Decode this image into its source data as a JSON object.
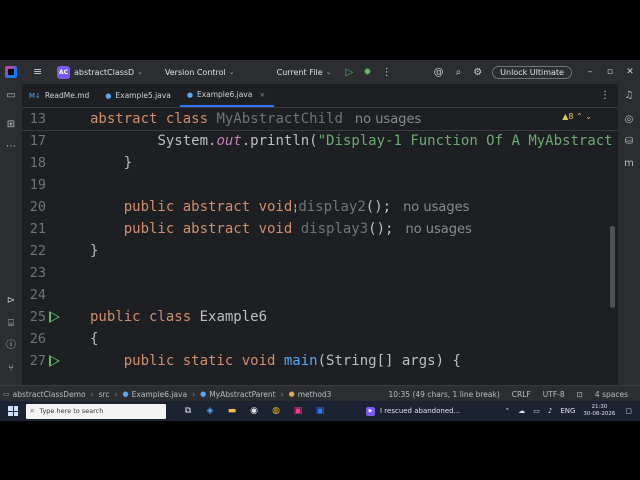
{
  "titlebar": {
    "project_badge": "AC",
    "project_name": "abstractClassD...",
    "vcs": "Version Control",
    "run_config": "Current File",
    "unlock": "Unlock Ultimate"
  },
  "tabs": [
    {
      "label": "ReadMe.md",
      "icon": "M↓",
      "active": false
    },
    {
      "label": "Example5.java",
      "icon": "●",
      "active": false
    },
    {
      "label": "Example6.java",
      "icon": "●",
      "active": true,
      "close": "×"
    }
  ],
  "editor": {
    "sticky": {
      "num": "13",
      "kw": "abstract class",
      "name": "MyAbstractChild",
      "hint": "no usages"
    },
    "inspection": "▲8  ⌃  ⌄",
    "lines": [
      {
        "num": "17",
        "indent": "        ",
        "pre": "System.",
        "field": "out",
        "mid": ".println(",
        "str": "\"Display-1 Function Of A MyAbstract"
      },
      {
        "num": "18",
        "indent": "    ",
        "text": "}"
      },
      {
        "num": "19"
      },
      {
        "num": "20",
        "indent": "    ",
        "kw": "public abstract void",
        "cursor": "¦",
        "name": "display2",
        "rest": "();",
        "hint": "no usages"
      },
      {
        "num": "21",
        "indent": "    ",
        "kw": "public abstract void",
        "name": "display3",
        "rest": "();",
        "hint": "no usages"
      },
      {
        "num": "22",
        "text": "}"
      },
      {
        "num": "23"
      },
      {
        "num": "24"
      },
      {
        "num": "25",
        "kw": "public class",
        "name": "Example6",
        "run": true
      },
      {
        "num": "26",
        "text": "{"
      },
      {
        "num": "27",
        "indent": "    ",
        "kw": "public static void",
        "fn": "main",
        "rest": "(String[] args) {",
        "run": true
      }
    ]
  },
  "statusbar": {
    "crumbs": [
      "abstractClassDemo",
      "src",
      "Example6.java",
      "MyAbstractParent",
      "method3"
    ],
    "position": "10:35 (49 chars, 1 line break)",
    "line_sep": "CRLF",
    "encoding": "UTF-8",
    "indent": "4 spaces"
  },
  "taskbar": {
    "search_placeholder": "Type here to search",
    "media_title": "I rescued abandoned...",
    "lang": "ENG",
    "time": "21:30",
    "date": "30-08-2026"
  }
}
